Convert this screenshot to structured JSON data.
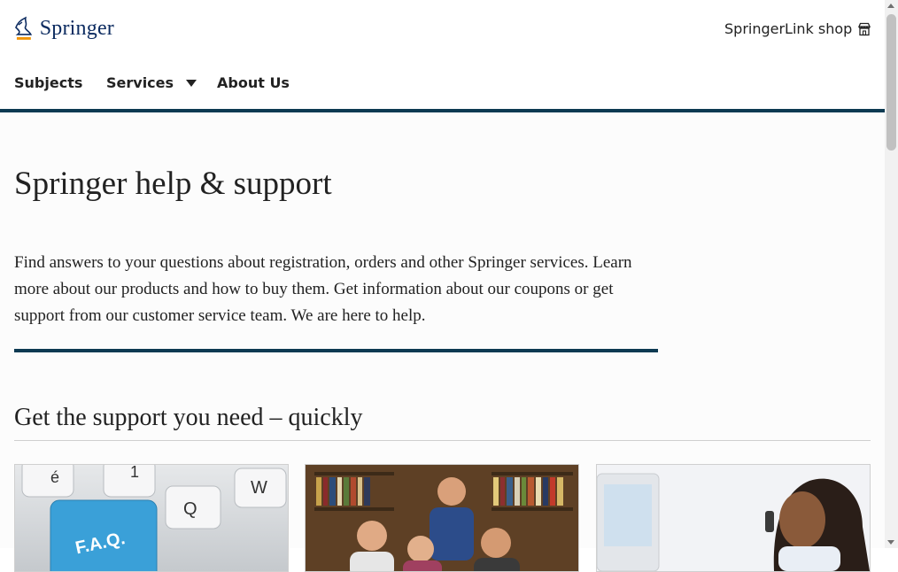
{
  "header": {
    "logo_text": "Springer",
    "shop_link_label": "SpringerLink shop",
    "shop_icon": "storefront-icon"
  },
  "nav": {
    "items": [
      {
        "label": "Subjects"
      },
      {
        "label": "Services",
        "has_dropdown": true
      },
      {
        "label": "About Us"
      }
    ]
  },
  "main": {
    "title": "Springer help & support",
    "intro": "Find answers to your questions about registration, orders and other Springer services. Learn more about our products and how to buy them. Get information about our coupons or get support from our customer service team. We are here to help.",
    "section_title": "Get the support you need – quickly",
    "cards": [
      {
        "image": "faq-keyboard-photo",
        "key_labels": [
          "é",
          "1",
          "W",
          "Q",
          "F.A.Q."
        ]
      },
      {
        "image": "group-in-library-photo"
      },
      {
        "image": "woman-on-phone-photo"
      }
    ]
  },
  "colors": {
    "brand_navy": "#0d3a52",
    "logo_blue": "#0c2b60",
    "logo_accent": "#f29400"
  }
}
